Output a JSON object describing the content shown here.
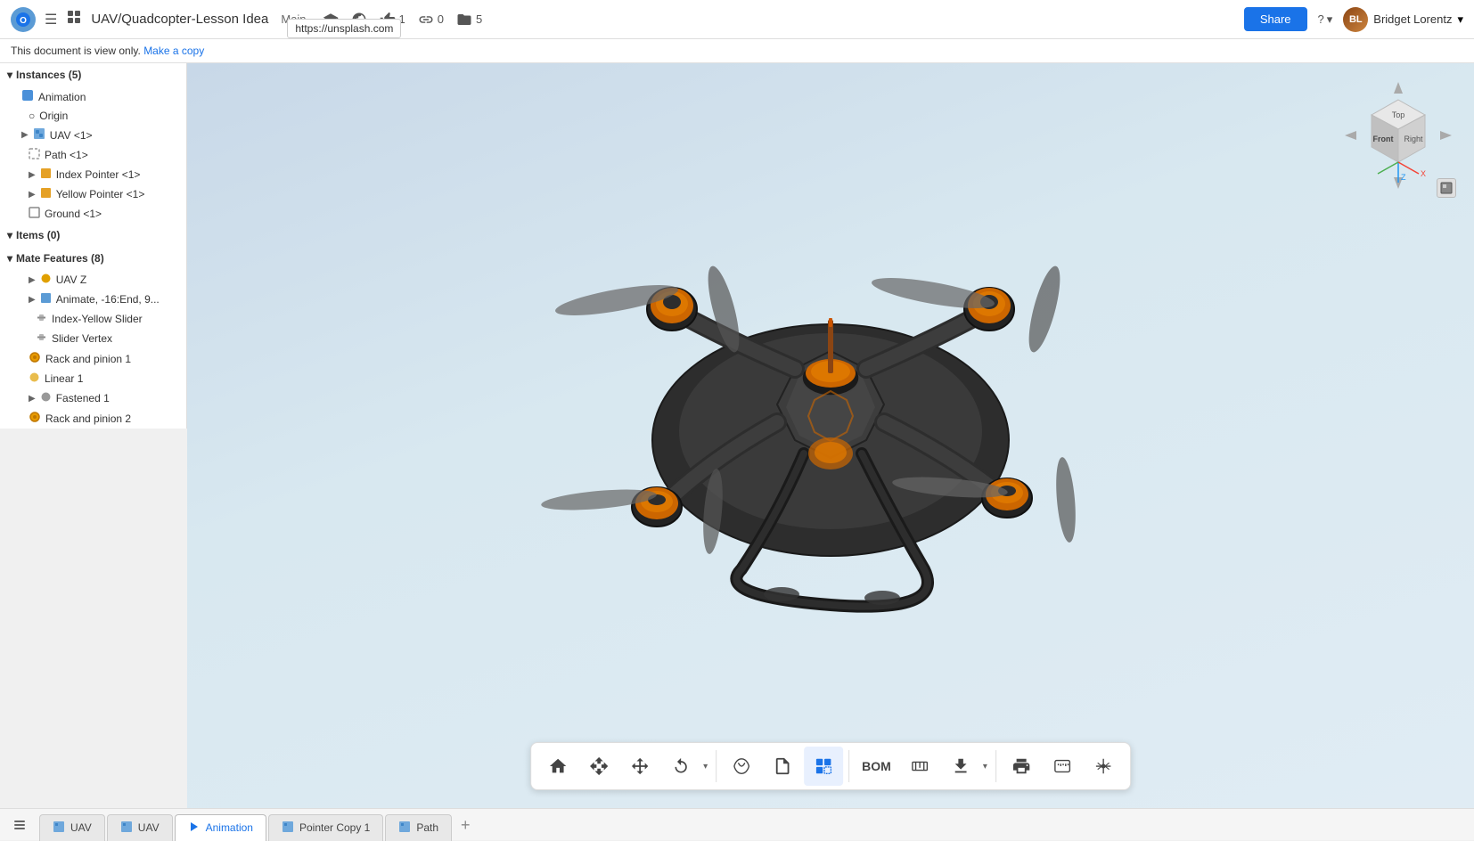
{
  "app": {
    "logo_text": "O",
    "doc_title": "UAV/Quadcopter-Lesson Idea",
    "doc_branch": "Main",
    "tooltip_url": "https://unsplash.com"
  },
  "navbar": {
    "share_btn": "Share",
    "help_icon": "?",
    "user_name": "Bridget Lorentz",
    "user_initials": "BL",
    "likes_count": "1",
    "links_count": "0",
    "files_count": "5"
  },
  "banner": {
    "text": "This document is view only.",
    "link_text": "Make a copy"
  },
  "sidebar": {
    "instances_header": "Instances (5)",
    "items": [
      {
        "id": "animation",
        "label": "Animation",
        "indent": 1,
        "icon": "assembly",
        "expandable": false
      },
      {
        "id": "origin",
        "label": "Origin",
        "indent": 2,
        "icon": "origin",
        "expandable": false
      },
      {
        "id": "uav1",
        "label": "UAV <1>",
        "indent": 1,
        "icon": "assembly",
        "expandable": true
      },
      {
        "id": "path1",
        "label": "Path <1>",
        "indent": 2,
        "icon": "path",
        "expandable": false
      },
      {
        "id": "index-pointer1",
        "label": "Index Pointer <1>",
        "indent": 2,
        "icon": "pointer",
        "expandable": true
      },
      {
        "id": "yellow-pointer1",
        "label": "Yellow Pointer <1>",
        "indent": 2,
        "icon": "pointer",
        "expandable": true
      },
      {
        "id": "ground1",
        "label": "Ground <1>",
        "indent": 2,
        "icon": "ground",
        "expandable": false
      }
    ],
    "items_header": "Items (0)",
    "mate_features_header": "Mate Features (8)",
    "mate_items": [
      {
        "id": "uav-z",
        "label": "UAV Z",
        "indent": 2,
        "icon": "mate",
        "expandable": true
      },
      {
        "id": "animate",
        "label": "Animate, -16:End, 9...",
        "indent": 2,
        "icon": "animate",
        "expandable": true
      },
      {
        "id": "index-yellow-slider",
        "label": "Index-Yellow Slider",
        "indent": 3,
        "icon": "slider"
      },
      {
        "id": "slider-vertex",
        "label": "Slider Vertex",
        "indent": 3,
        "icon": "slider"
      },
      {
        "id": "rack-pinion-1",
        "label": "Rack and pinion 1",
        "indent": 2,
        "icon": "gear"
      },
      {
        "id": "linear-1",
        "label": "Linear 1",
        "indent": 2,
        "icon": "mate"
      },
      {
        "id": "fastened-1",
        "label": "Fastened 1",
        "indent": 2,
        "icon": "fastened",
        "expandable": true
      },
      {
        "id": "rack-pinion-2",
        "label": "Rack and pinion 2",
        "indent": 2,
        "icon": "gear"
      }
    ]
  },
  "viewport": {
    "nav_cube": {
      "top_label": "Top",
      "front_label": "Front",
      "right_label": "Right"
    }
  },
  "toolbar": {
    "buttons": [
      {
        "id": "home",
        "icon": "⌂",
        "label": "Home"
      },
      {
        "id": "move-view",
        "icon": "✛",
        "label": "Move view"
      },
      {
        "id": "translate",
        "icon": "⊕",
        "label": "Translate"
      },
      {
        "id": "rotate",
        "icon": "⟳",
        "label": "Rotate",
        "has_dropdown": true
      },
      {
        "id": "shape",
        "icon": "◈",
        "label": "Shape"
      },
      {
        "id": "notes",
        "icon": "≡",
        "label": "Notes"
      },
      {
        "id": "box-select",
        "icon": "⬜",
        "label": "Box select",
        "active": true
      },
      {
        "id": "bom",
        "label": "BOM",
        "text_only": true
      },
      {
        "id": "measure",
        "icon": "📐",
        "label": "Measure"
      },
      {
        "id": "download",
        "icon": "⬇",
        "label": "Download",
        "has_dropdown": true
      },
      {
        "id": "print",
        "icon": "🖨",
        "label": "Print"
      },
      {
        "id": "tape",
        "icon": "📏",
        "label": "Tape measure"
      },
      {
        "id": "scale",
        "icon": "⚖",
        "label": "Scale"
      }
    ]
  },
  "tabs": [
    {
      "id": "uav-tab",
      "label": "UAV",
      "icon": "▣",
      "active": false
    },
    {
      "id": "uav-tab-2",
      "label": "UAV",
      "icon": "▣",
      "active": false
    },
    {
      "id": "animation-tab",
      "label": "Animation",
      "icon": "▷",
      "active": true
    },
    {
      "id": "pointer-copy-tab",
      "label": "Pointer Copy 1",
      "icon": "▣",
      "active": false
    },
    {
      "id": "path-tab",
      "label": "Path",
      "icon": "▣",
      "active": false
    }
  ]
}
